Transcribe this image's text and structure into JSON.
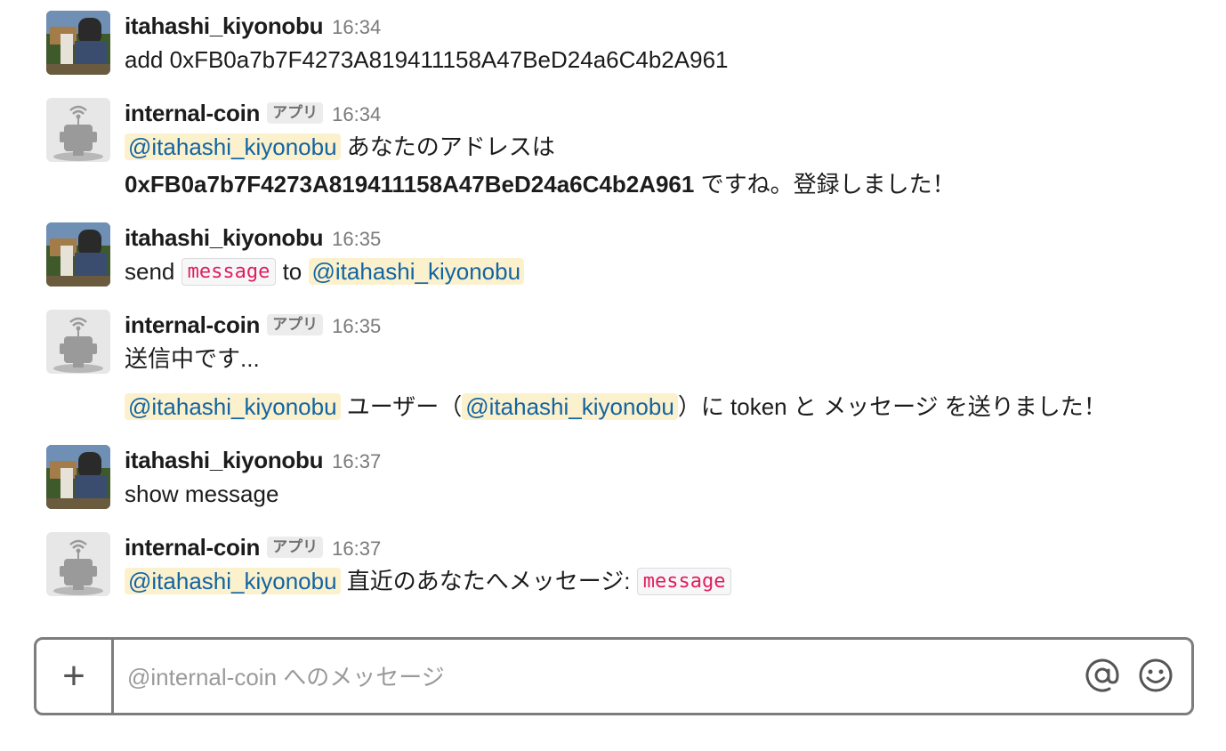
{
  "messages": [
    {
      "user": "itahashi_kiyonobu",
      "time": "16:34",
      "text": "add 0xFB0a7b7F4273A819411158A47BeD24a6C4b2A961"
    },
    {
      "user": "internal-coin",
      "badge": "アプリ",
      "time": "16:34",
      "mention": "@itahashi_kiyonobu",
      "text_after_mention": "あなたのアドレスは",
      "address_bold": "0xFB0a7b7F4273A819411158A47BeD24a6C4b2A961",
      "text_after_address": "ですね。登録しました！"
    },
    {
      "user": "itahashi_kiyonobu",
      "time": "16:35",
      "text_prefix": "send",
      "code": "message",
      "text_middle": "to",
      "mention": "@itahashi_kiyonobu"
    },
    {
      "user": "internal-coin",
      "badge": "アプリ",
      "time": "16:35",
      "text": "送信中です...",
      "mention1": "@itahashi_kiyonobu",
      "text_a": "ユーザー（",
      "mention2": "@itahashi_kiyonobu",
      "text_b": "）に token と メッセージ を送りました！"
    },
    {
      "user": "itahashi_kiyonobu",
      "time": "16:37",
      "text": "show message"
    },
    {
      "user": "internal-coin",
      "badge": "アプリ",
      "time": "16:37",
      "mention": "@itahashi_kiyonobu",
      "text_after_mention": "直近のあなたへメッセージ:",
      "code": "message"
    }
  ],
  "composer": {
    "plus_label": "+",
    "placeholder": "@internal-coin へのメッセージ",
    "value": ""
  },
  "icons": {
    "attach": "plus-icon",
    "mention": "at-sign-icon",
    "emoji": "smiley-icon"
  }
}
